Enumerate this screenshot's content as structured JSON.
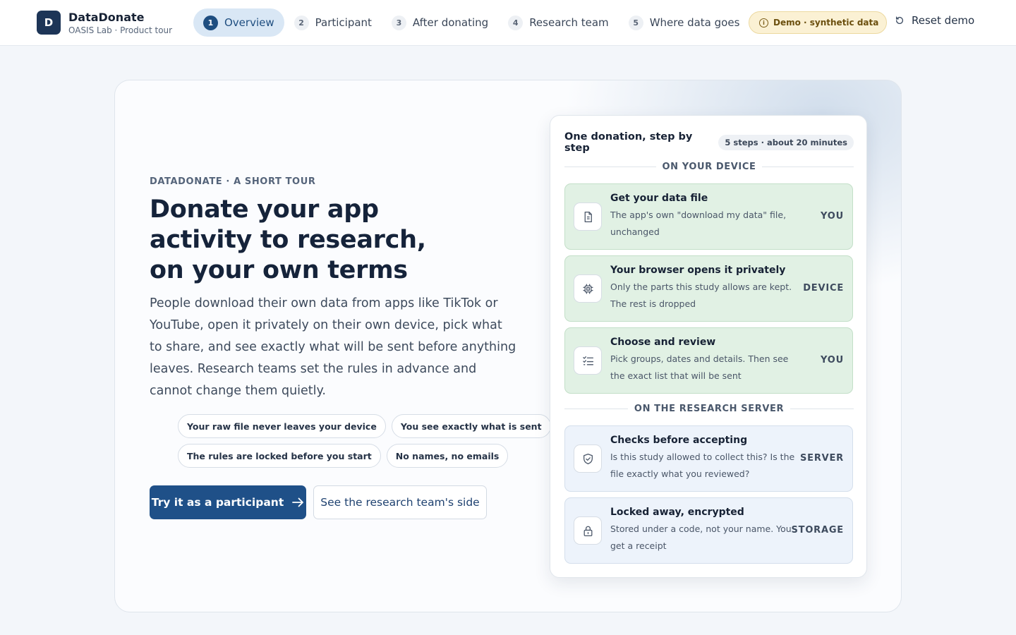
{
  "brand": {
    "logo_letter": "D",
    "name": "DataDonate",
    "subtitle": "OASIS Lab · Product tour"
  },
  "nav": {
    "steps": [
      {
        "num": "1",
        "label": "Overview",
        "active": true
      },
      {
        "num": "2",
        "label": "Participant",
        "active": false
      },
      {
        "num": "3",
        "label": "After donating",
        "active": false
      },
      {
        "num": "4",
        "label": "Research team",
        "active": false
      },
      {
        "num": "5",
        "label": "Where data goes",
        "active": false
      }
    ],
    "demo_badge": "Demo · synthetic data",
    "reset_label": "Reset demo"
  },
  "hero": {
    "eyebrow": "DATADONATE · A SHORT TOUR",
    "headline": "Donate your app activity to research, on your own terms",
    "lede": "People download their own data from apps like TikTok or YouTube, open it privately on their own device, pick what to share, and see exactly what will be sent before anything leaves. Research teams set the rules in advance and cannot change them quietly.",
    "chips": [
      "Your raw file never leaves your device",
      "You see exactly what is sent",
      "The rules are locked before you start",
      "No names, no emails"
    ],
    "primary_cta": "Try it as a participant",
    "secondary_cta": "See the research team's side"
  },
  "panel": {
    "title": "One donation, step by step",
    "pill": "5 steps · about 20 minutes",
    "section_device": "ON YOUR DEVICE",
    "section_server": "ON THE RESEARCH SERVER",
    "items": [
      {
        "icon": "file-icon",
        "title": "Get your data file",
        "desc": "The app's own \"download my data\" file, unchanged",
        "tag": "YOU"
      },
      {
        "icon": "chip-icon",
        "title": "Your browser opens it privately",
        "desc": "Only the parts this study allows are kept. The rest is dropped",
        "tag": "DEVICE"
      },
      {
        "icon": "checklist-icon",
        "title": "Choose and review",
        "desc": "Pick groups, dates and details. Then see the exact list that will be sent",
        "tag": "YOU"
      },
      {
        "icon": "shield-check-icon",
        "title": "Checks before accepting",
        "desc": "Is this study allowed to collect this? Is the file exactly what you reviewed?",
        "tag": "SERVER"
      },
      {
        "icon": "lock-icon",
        "title": "Locked away, encrypted",
        "desc": "Stored under a code, not your name. You get a receipt",
        "tag": "STORAGE"
      }
    ]
  },
  "colors": {
    "brand_dark": "#1d3557",
    "primary_button": "#1f5088",
    "active_step_bg": "#d9e7f5",
    "device_item_bg": "#e1f1e4",
    "server_item_bg": "#edf3fb",
    "demo_badge_bg": "#fbf1d4"
  }
}
